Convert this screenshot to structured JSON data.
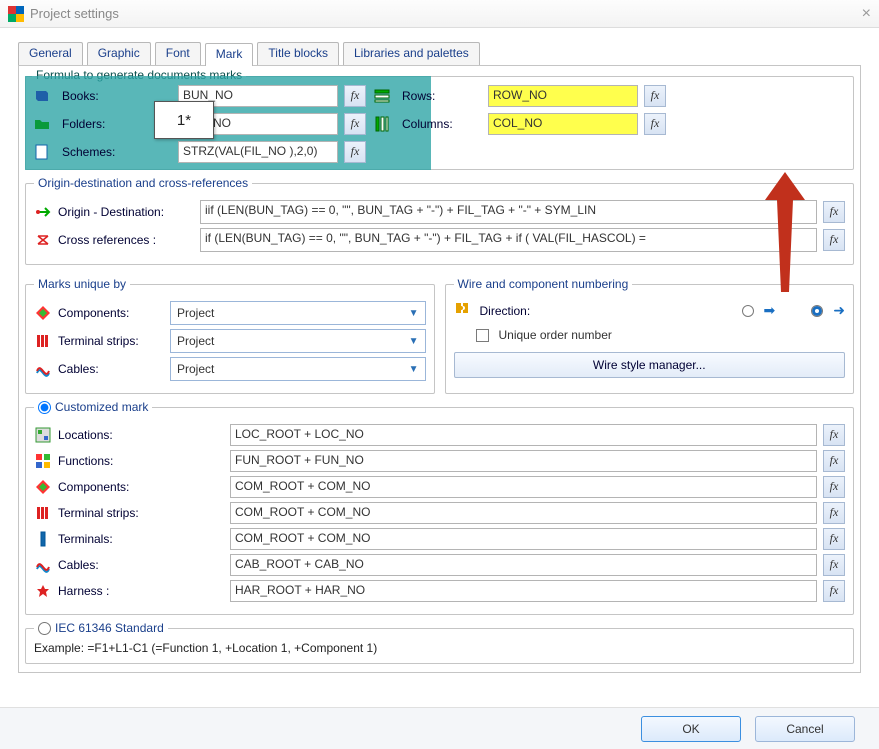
{
  "window": {
    "title": "Project settings"
  },
  "tabs": [
    "General",
    "Graphic",
    "Font",
    "Mark",
    "Title blocks",
    "Libraries and palettes"
  ],
  "active_tab": "Mark",
  "formula_section": {
    "title": "Formula to generate documents marks",
    "callout": "1*",
    "books_label": "Books:",
    "books_formula": "BUN_NO",
    "folders_label": "Folders:",
    "folders_formula": "FOL_NO",
    "schemes_label": "Schemes:",
    "schemes_formula": "STRZ(VAL(FIL_NO ),2,0)",
    "rows_label": "Rows:",
    "rows_formula": "ROW_NO",
    "columns_label": "Columns:",
    "columns_formula": "COL_NO"
  },
  "origin_section": {
    "title": "Origin-destination and cross-references",
    "origin_label": "Origin - Destination:",
    "origin_formula": "iif (LEN(BUN_TAG) == 0, \"\", BUN_TAG + \"-\") + FIL_TAG + \"-\" + SYM_LIN",
    "xref_label": "Cross references :",
    "xref_formula": "if (LEN(BUN_TAG) == 0, \"\", BUN_TAG + \"-\") + FIL_TAG + if ( VAL(FIL_HASCOL) ="
  },
  "unique_section": {
    "title": "Marks unique by",
    "components_label": "Components:",
    "components_scope": "Project",
    "tstrips_label": "Terminal strips:",
    "tstrips_scope": "Project",
    "cables_label": "Cables:",
    "cables_scope": "Project"
  },
  "wire_section": {
    "title": "Wire and component numbering",
    "direction_label": "Direction:",
    "unique_order_label": "Unique order number",
    "wsm_label": "Wire style manager..."
  },
  "custom_section": {
    "title": "Customized mark",
    "rows": [
      {
        "label": "Locations:",
        "value": "LOC_ROOT + LOC_NO"
      },
      {
        "label": "Functions:",
        "value": "FUN_ROOT + FUN_NO"
      },
      {
        "label": "Components:",
        "value": "COM_ROOT + COM_NO"
      },
      {
        "label": "Terminal strips:",
        "value": "COM_ROOT + COM_NO"
      },
      {
        "label": "Terminals:",
        "value": "COM_ROOT + COM_NO"
      },
      {
        "label": "Cables:",
        "value": "CAB_ROOT + CAB_NO"
      },
      {
        "label": "Harness :",
        "value": "HAR_ROOT + HAR_NO"
      }
    ]
  },
  "iec_section": {
    "title": "IEC 61346 Standard",
    "example": "Example: =F1+L1-C1 (=Function 1, +Location 1, +Component 1)"
  },
  "buttons": {
    "ok": "OK",
    "cancel": "Cancel"
  },
  "fx": "fx"
}
